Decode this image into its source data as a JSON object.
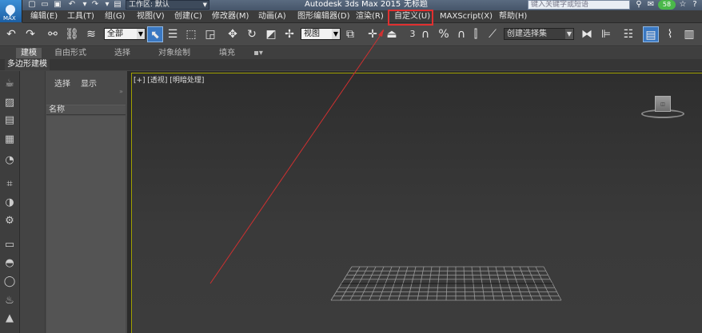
{
  "title_bar": {
    "app_name": "Autodesk 3ds Max  2015",
    "doc_name": "无标题",
    "workspace": "工作区: 默认",
    "help_search_placeholder": "键入关键字或短语",
    "logo_text": "MAX",
    "user_badge": "58"
  },
  "menu": {
    "items": [
      "编辑(E)",
      "工具(T)",
      "组(G)",
      "视图(V)",
      "创建(C)",
      "修改器(M)",
      "动画(A)",
      "图形编辑器(D)",
      "渲染(R)",
      "自定义(U)",
      "MAXScript(X)",
      "帮助(H)"
    ],
    "highlighted_item": "自定义(U)"
  },
  "toolbar": {
    "filter_combo": "全部",
    "refcoord_combo": "视图",
    "snap_number": "3",
    "selection_set": "创建选择集"
  },
  "ribbon": {
    "tabs": [
      "建模",
      "自由形式",
      "选择",
      "对象绘制",
      "填充"
    ],
    "sub_label": "多边形建模"
  },
  "scene_explorer": {
    "tabs": [
      "选择",
      "显示"
    ],
    "column_header": "名称"
  },
  "viewport": {
    "label": "[+] [透视] [明暗处理]"
  },
  "colors": {
    "highlight_box": "#e03030",
    "annotation_line": "#d03030",
    "active_button": "#3a78c2"
  }
}
